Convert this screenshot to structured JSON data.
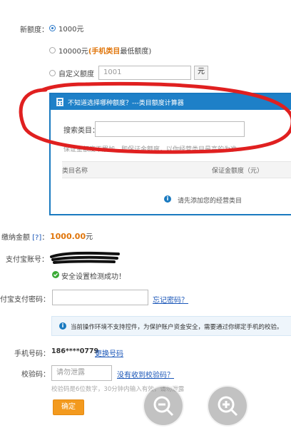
{
  "form": {
    "new_quota_label": "新额度：",
    "option1_amount": "1000元",
    "option2_amount": "10000元",
    "option2_category": "(手机类目",
    "option2_suffix": "最低额度)",
    "custom_label": "自定义额度",
    "custom_value": "1001",
    "unit": "元"
  },
  "panel": {
    "header": "不知道选择哪种额度？---类目额度计算器",
    "search_label": "搜索类目：",
    "note": "保证金额度不累加，即保证金额度，以你经营类目最高的为准",
    "col1": "类目名称",
    "col2": "保证金额度（元）",
    "empty_msg": "请先添加您的经营类目"
  },
  "payment": {
    "amount_label": "缴纳金额",
    "amount_help": "[?]",
    "amount_value": "1000.00",
    "amount_unit": "元",
    "account_label": "支付宝账号：",
    "security_msg": "安全设置检测成功！",
    "password_label": "付宝支付密码：",
    "forgot_link": "忘记密码？",
    "notice": "当前操作环境不支持控件，为保护账户资金安全，需要通过你绑定手机的校验。",
    "phone_label": "手机号码：",
    "phone_value": "186****0779",
    "change_phone_link": "更换号码",
    "code_label": "校验码：",
    "code_placeholder": "请勿泄露",
    "no_code_link": "没有收到校验码？",
    "code_hint": "校验码是6位数字，30分钟内输入有效，请勿泄露",
    "confirm_label": "确定"
  },
  "colors": {
    "accent_blue": "#1e80c8",
    "orange": "#f39a1e",
    "amount_orange": "#e0750a",
    "red_marker": "#e02020"
  }
}
